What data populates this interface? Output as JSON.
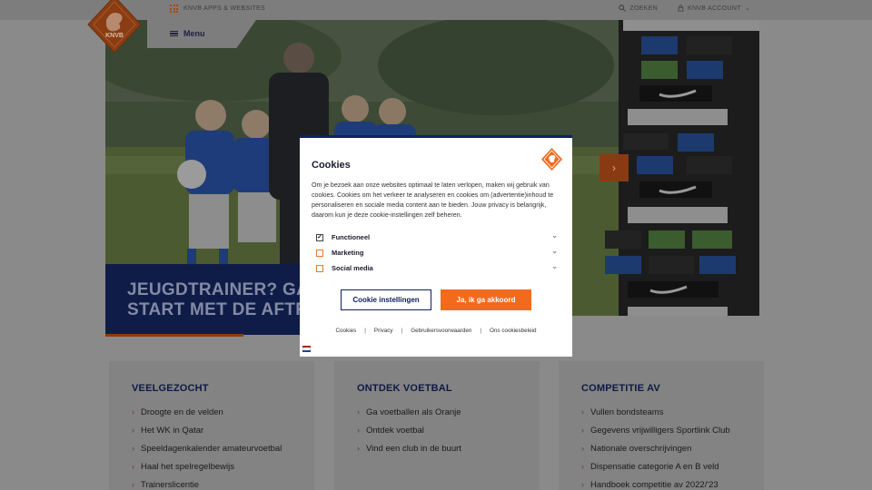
{
  "topbar": {
    "apps_label": "KNVB APPS & WEBSITES",
    "search_label": "ZOEKEN",
    "account_label": "KNVB ACCOUNT"
  },
  "logo_text": "KNVB",
  "menu": {
    "label": "Menu"
  },
  "hero": {
    "headline": "JEUGDTRAINER? GA C\nSTART MET DE AFTRA",
    "sponsor_brands": [
      "ING",
      "bitvavo",
      "kpn",
      "Albert Heijn",
      "Nike"
    ]
  },
  "cookie_modal": {
    "title": "Cookies",
    "description": "Om je bezoek aan onze websites optimaal te laten verlopen, maken wij gebruik van cookies. Cookies om het verkeer te analyseren en cookies om (advertentie)inhoud te personaliseren en sociale media content aan te bieden. Jouw privacy is belangrijk, daarom kun je deze cookie-instellingen zelf beheren.",
    "options": [
      {
        "label": "Functioneel",
        "checked": true
      },
      {
        "label": "Marketing",
        "checked": false
      },
      {
        "label": "Social media",
        "checked": false
      }
    ],
    "settings_button": "Cookie instellingen",
    "accept_button": "Ja, ik ga akkoord",
    "links": [
      "Cookies",
      "Privacy",
      "Gebruikersvoorwaarden",
      "Ons cookiesbeleid"
    ],
    "separator": "|"
  },
  "cards": [
    {
      "title": "VEELGEZOCHT",
      "items": [
        "Droogte en de velden",
        "Het WK in Qatar",
        "Speeldagenkalender amateurvoetbal",
        "Haal het spelregelbewijs",
        "Trainerslicentie"
      ]
    },
    {
      "title": "ONTDEK VOETBAL",
      "items": [
        "Ga voetballen als Oranje",
        "Ontdek voetbal",
        "Vind een club in de buurt"
      ]
    },
    {
      "title": "COMPETITIE AV",
      "items": [
        "Vullen bondsteams",
        "Gegevens vrijwilligers Sportlink Club",
        "Nationale overschrijvingen",
        "Dispensatie categorie A en B veld",
        "Handboek competitie av 2022/'23"
      ]
    }
  ],
  "colors": {
    "brand_orange": "#f26b1d",
    "navy": "#0f2063",
    "overlay_bg": "#8a8a8a"
  }
}
